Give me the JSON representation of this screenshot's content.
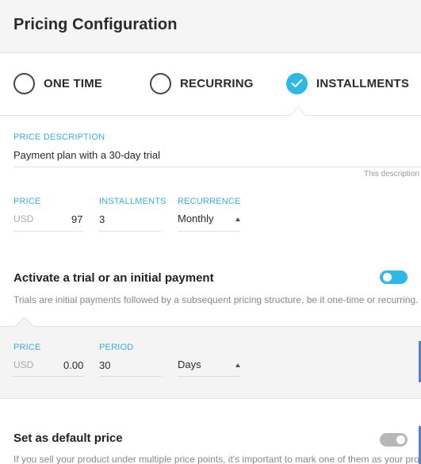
{
  "header": {
    "title": "Pricing Configuration"
  },
  "price_types": [
    {
      "label": "ONE TIME",
      "selected": false
    },
    {
      "label": "RECURRING",
      "selected": false
    },
    {
      "label": "INSTALLMENTS",
      "selected": true
    }
  ],
  "description": {
    "label": "PRICE DESCRIPTION",
    "value": "Payment plan with a 30-day trial",
    "hint": "This description"
  },
  "price": {
    "label": "PRICE",
    "currency": "USD",
    "amount": "97"
  },
  "installments": {
    "label": "INSTALLMENTS",
    "value": "3"
  },
  "recurrence": {
    "label": "RECURRENCE",
    "value": "Monthly"
  },
  "trial": {
    "title": "Activate a trial or an initial payment",
    "description": "Trials are initial payments followed by a subsequent pricing structure, be it one-time or recurring.",
    "enabled": true,
    "price_label": "PRICE",
    "currency": "USD",
    "amount": "0.00",
    "period_label": "PERIOD",
    "period_value": "30",
    "period_unit": "Days"
  },
  "default_price": {
    "title": "Set as default price",
    "description": "If you sell your product under multiple price points, it's important to mark one of them as your prod",
    "enabled": false
  },
  "colors": {
    "accent": "#2eb8e6",
    "label": "#3aaee0",
    "scroll_marker": "#5a7fcf"
  }
}
